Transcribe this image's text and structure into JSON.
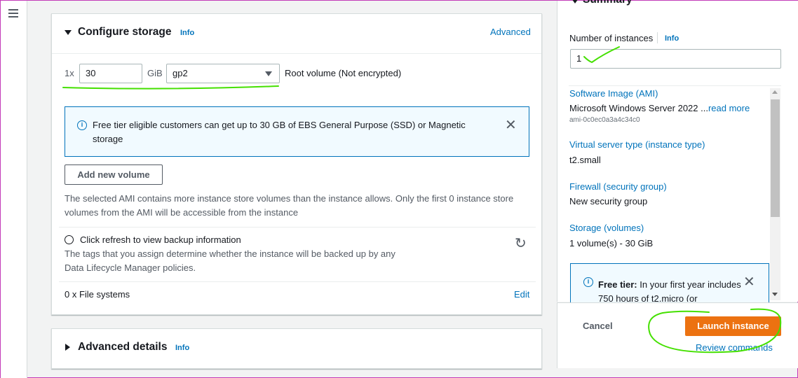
{
  "storage": {
    "title": "Configure storage",
    "info": "Info",
    "advanced": "Advanced",
    "multiplier": "1x",
    "size": "30",
    "unit": "GiB",
    "volume_type": "gp2",
    "root_label": "Root volume  (Not encrypted)",
    "alert_text": "Free tier eligible customers can get up to 30 GB of EBS General Purpose (SSD) or Magnetic storage",
    "add_volume": "Add new volume",
    "instance_store_note": "The selected AMI contains more instance store volumes than the instance allows. Only the first 0 instance store volumes from the AMI will be accessible from the instance",
    "backup_title": "Click refresh to view backup information",
    "backup_desc": "The tags that you assign determine whether the instance will be backed up by any Data Lifecycle Manager policies.",
    "file_systems": "0 x File systems",
    "edit": "Edit"
  },
  "advanced_details": {
    "title": "Advanced details",
    "info": "Info"
  },
  "summary": {
    "title": "Summary",
    "num_label": "Number of instances",
    "info": "Info",
    "num_value": "1",
    "ami_label": "Software Image (AMI)",
    "ami_value": "Microsoft Windows Server 2022 ...",
    "read_more": "read more",
    "ami_id": "ami-0c0ec0a3a4c34c0",
    "type_label": "Virtual server type (instance type)",
    "type_value": "t2.small",
    "fw_label": "Firewall (security group)",
    "fw_value": "New security group",
    "storage_label": "Storage (volumes)",
    "storage_value": "1 volume(s) - 30 GiB",
    "free_tier_bold": "Free tier:",
    "free_tier_text": "In your first year includes 750 hours of t2.micro (or",
    "cancel": "Cancel",
    "launch": "Launch instance",
    "review": "Review commands"
  },
  "colors": {
    "accent": "#0073bb",
    "primary": "#ec7211",
    "annotation": "#44e000"
  }
}
